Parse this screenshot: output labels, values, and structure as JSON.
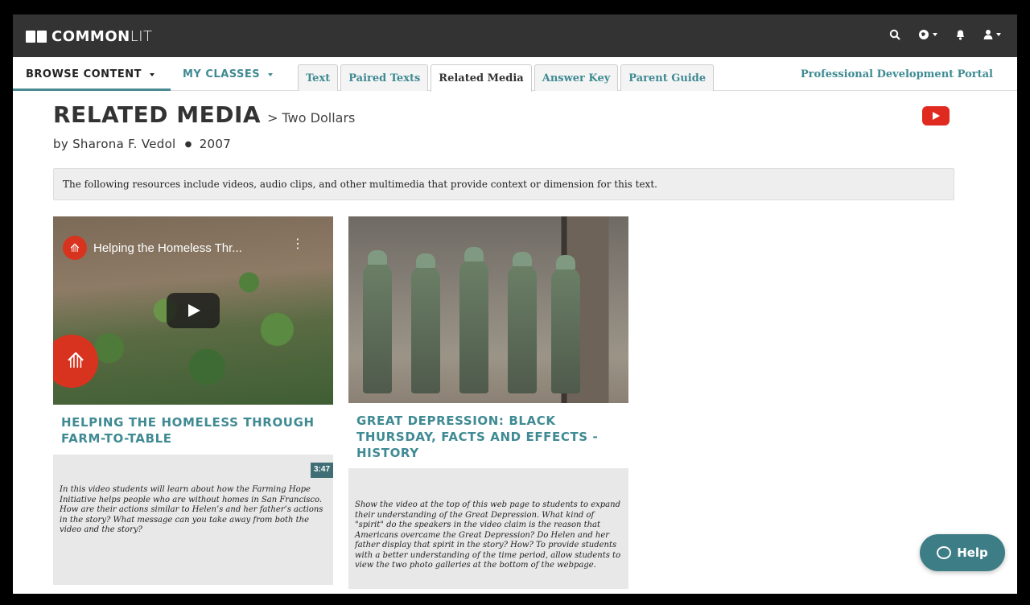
{
  "app": {
    "logo_bold": "COMMON",
    "logo_light": "LIT",
    "icons": [
      "search-icon",
      "globe-icon",
      "bell-icon",
      "user-icon"
    ]
  },
  "nav": {
    "browse_label": "BROWSE CONTENT",
    "classes_label": "MY CLASSES",
    "tabs": [
      {
        "label": "Text",
        "active": false
      },
      {
        "label": "Paired Texts",
        "active": false
      },
      {
        "label": "Related Media",
        "active": true
      },
      {
        "label": "Answer Key",
        "active": false
      },
      {
        "label": "Parent Guide",
        "active": false
      }
    ],
    "pd_portal": "Professional Development Portal"
  },
  "page": {
    "heading": "RELATED MEDIA",
    "subheading": "> Two Dollars",
    "author": "by Sharona F. Vedol",
    "bullet": "●",
    "year": "2007",
    "info": "The following resources include videos, audio clips, and other multimedia that provide context or dimension for this text."
  },
  "cards": [
    {
      "video_title": "Helping the Homeless Thr...",
      "title": "HELPING THE HOMELESS THROUGH FARM-TO-TABLE",
      "duration": "3:47",
      "description": "In this video students will learn about how the Farming Hope Initiative helps people who are without homes in San Francisco. How are their actions similar to Helen’s and her father’s actions in the story? What message can you take away from both the video and the story?"
    },
    {
      "title": "GREAT DEPRESSION: BLACK THURSDAY, FACTS AND EFFECTS - HISTORY",
      "description": "Show the video at the top of this web page to students to expand their understanding of the Great Depression. What kind of \"spirit\" do the speakers in the video claim is the reason that Americans overcame the Great Depression? Do Helen and her father display that spirit in the story? How? To provide students with a better understanding of the time period, allow students to view the two photo galleries at the bottom of the webpage."
    }
  ],
  "help": {
    "label": "Help"
  },
  "colors": {
    "accent": "#3f8a93",
    "topbar": "#333333",
    "youtube": "#e02a20"
  }
}
